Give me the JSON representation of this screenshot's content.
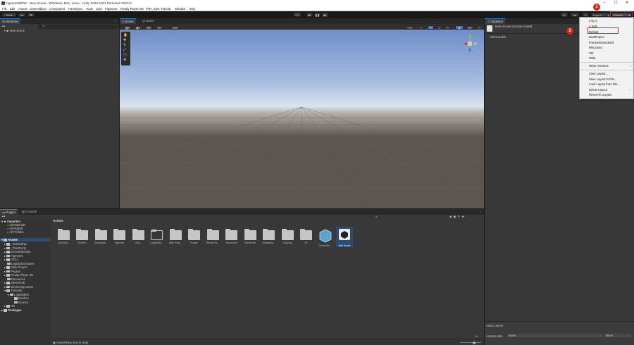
{
  "window": {
    "title": "FigmentsNRW - New Scene - Windows, Mac, Linux - Unity 2023.3.5f1 Personal <DX11>",
    "controls": [
      "–",
      "☐",
      "✕"
    ]
  },
  "menubar": [
    "File",
    "Edit",
    "Assets",
    "GameObject",
    "Component",
    "PanelSync",
    "Tools",
    "Jobs",
    "Figments",
    "Ready Player Me",
    "P3R_SDK",
    "Tutorial",
    "Window",
    "Help"
  ],
  "toolbar": {
    "account": "NM",
    "layers_label": "Layers",
    "layout_label": "Default"
  },
  "hierarchy": {
    "tab": "Hierarchy",
    "search_placeholder": "All",
    "scene": "New Scene"
  },
  "scene_view": {
    "tabs": [
      "Scene",
      "Game"
    ],
    "mode_2d": "2D"
  },
  "inspector": {
    "tab": "Inspector",
    "asset_title": "New Scene (Scene Asset)",
    "addressable": "Addressable",
    "asset_labels": "Asset Labels",
    "asset_bundle_label": "AssetBundle",
    "asset_bundle_value": "None",
    "variant_value": "None"
  },
  "project": {
    "tabs": [
      "Project",
      "Console"
    ],
    "breadcrumb": "Assets",
    "favorites_title": "Favorites",
    "favorites": [
      "All Materials",
      "All Models",
      "All Prefabs"
    ],
    "assets_title": "Assets",
    "tree": [
      "_DoNotShip",
      "_ThirdParty",
      "DemoMaterials",
      "Figments",
      "GinLL",
      "LogicEditorSaves",
      "Main Project",
      "Plugins",
      "Ready Player Me",
      "Resources",
      "SketchFab",
      "StreamingAssets",
      "Tutorials",
      "LogicEditor",
      "Meshes",
      "Scenes",
      "XR"
    ],
    "packages_title": "Packages",
    "assets": [
      "_DoNotSh...",
      "_ThirdPa...",
      "DemoMate...",
      "Figments",
      "GinLL",
      "LogicEdito...",
      "Main Proje...",
      "Plugins",
      "Ready Pla...",
      "Resources",
      "SketchFab",
      "Streaming...",
      "Tutorials",
      "XR",
      "DefaultNe...",
      "New Scene"
    ],
    "status_path": "Assets/New Scene.unity",
    "count": "16"
  },
  "layout_menu": {
    "items": [
      "2 by 3",
      "4 Split",
      "Default",
      "DualProject",
      "FreeswimStandard",
      "NNLayout",
      "Tall",
      "Wide"
    ],
    "other_versions": "Other Versions",
    "actions": [
      "Save Layout...",
      "Save Layout to File...",
      "Load Layout from File...",
      "Delete Layout",
      "Reset All Layouts"
    ]
  },
  "annotations": [
    "1",
    "2"
  ],
  "colors": {
    "sky_top": "#6e8ec9",
    "horizon": "#dbe3ec",
    "ground": "#5b5650",
    "accent": "#3a79bb",
    "annotation_red": "#d9261c"
  }
}
